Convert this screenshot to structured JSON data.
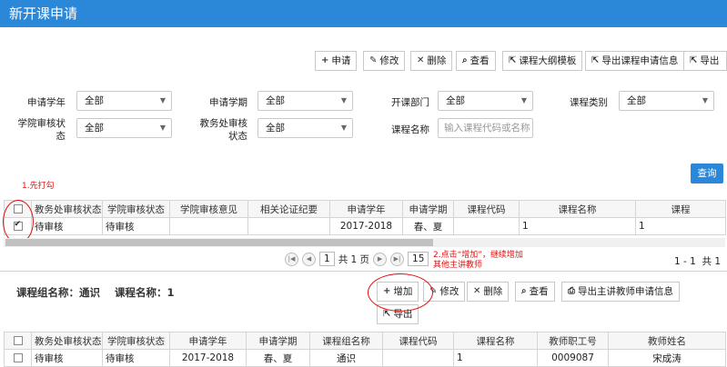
{
  "window": {
    "title": "新开课申请"
  },
  "toolbar": {
    "apply": "申请",
    "edit": "修改",
    "delete": "删除",
    "view": "查看",
    "syllabus": "课程大纲模板",
    "export_apply": "导出课程申请信息",
    "export": "导出"
  },
  "filters": {
    "year_label": "申请学年",
    "year_value": "全部",
    "term_label": "申请学期",
    "term_value": "全部",
    "dept_label": "开课部门",
    "dept_value": "全部",
    "type_label": "课程类别",
    "type_value": "全部",
    "college_label": "学院审核状态",
    "college_value": "全部",
    "office_label": "教务处审核状态",
    "office_value": "全部",
    "name_label": "课程名称",
    "name_placeholder": "输入课程代码或名称",
    "query": "查询"
  },
  "annotations": {
    "step1": "1.先打勾",
    "step2": "2.点击“增加”，继续增加其他主讲教师"
  },
  "main_table": {
    "headers": [
      "教务处审核状态",
      "学院审核状态",
      "学院审核意见",
      "相关论证纪要",
      "申请学年",
      "申请学期",
      "课程代码",
      "课程名称",
      "课程"
    ],
    "rows": [
      {
        "checked": true,
        "cells": [
          "待审核",
          "待审核",
          "",
          "",
          "2017-2018",
          "春、夏",
          "",
          "1",
          "1"
        ]
      }
    ]
  },
  "pager": {
    "page": "1",
    "total_pages": "共 1 页",
    "page_size": "15",
    "range": "1 - 1",
    "total": "共 1"
  },
  "sub": {
    "group_label": "课程组名称：",
    "group_value": "通识",
    "course_label": "课程名称：",
    "course_value": "1",
    "add": "增加",
    "edit": "修改",
    "delete": "删除",
    "view": "查看",
    "export_teacher": "导出主讲教师申请信息",
    "export": "导出"
  },
  "sub_table": {
    "headers": [
      "教务处审核状态",
      "学院审核状态",
      "申请学年",
      "申请学期",
      "课程组名称",
      "课程代码",
      "课程名称",
      "教师职工号",
      "教师姓名"
    ],
    "rows": [
      {
        "checked": false,
        "cells": [
          "待审核",
          "待审核",
          "2017-2018",
          "春、夏",
          "通识",
          "",
          "1",
          "0009087",
          "宋成涛"
        ]
      }
    ]
  },
  "colors": {
    "accent": "#2b88d9",
    "annotation": "#e01010"
  }
}
